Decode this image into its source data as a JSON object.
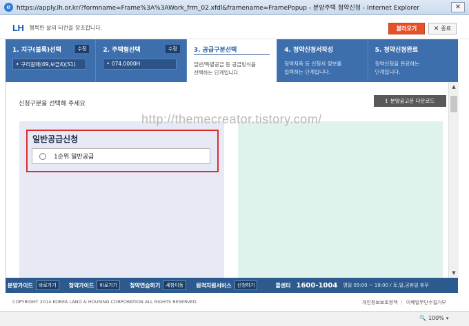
{
  "window": {
    "title": "https://apply.lh.or.kr/?formname=Frame%3A%3AWork_frm_02.xfdl&framename=FramePopup - 분양주택 청약신청 - Internet Explorer",
    "close_glyph": "✕"
  },
  "header": {
    "logo": "LH",
    "slogan": "행복한 삶의 터전을 창조합니다.",
    "load_button": "불러오기",
    "exit_button": "종료"
  },
  "steps": [
    {
      "title": "1. 지구(블록)선택",
      "edit": "수정",
      "value": "구리갈매(09,보금4)(S1)"
    },
    {
      "title": "2. 주택형선택",
      "edit": "수정",
      "value": "074.0000H"
    },
    {
      "title": "3. 공급구분선택",
      "desc_line1": "일반/특별공급 등 공급방식을",
      "desc_line2": "선택하는 단계입니다."
    },
    {
      "title": "4. 청약신청서작성",
      "desc_line1": "청약저축 등 신청서 정보를",
      "desc_line2": "입력하는 단계입니다."
    },
    {
      "title": "5. 청약신청완료",
      "desc_line1": "청약신청을 완료하는",
      "desc_line2": "단계입니다."
    }
  ],
  "main": {
    "instruction": "신청구분을 선택해 주세요",
    "download_button": "분양공고문 다운로드",
    "watermark": "http://themecreator.tistory.com/",
    "section_title": "일반공급신청",
    "option_label": "1순위 일반공급"
  },
  "footer_nav": {
    "items": [
      {
        "label": "분양가이드",
        "button": "바로가기"
      },
      {
        "label": "청약가이드",
        "button": "바로가기"
      },
      {
        "label": "청약연습하기",
        "button": "새창이동"
      },
      {
        "label": "원격지원서비스",
        "button": "신청하기"
      }
    ],
    "call_label": "콜센터",
    "phone": "1600-1004",
    "hours": "평일 09:00 ~ 18:00 / 토,일,공휴일 휴무"
  },
  "copyright": {
    "text": "COPYRIGHT 2014 KOREA LAND & HOUSING CORPORATION ALL RIGHTS RESERVED.",
    "privacy_link": "개인정보보호정책",
    "email_link": "이메일무단수집거부"
  },
  "statusbar": {
    "zoom": "100%"
  },
  "colors": {
    "accent": "#3e6fad",
    "highlight_border": "#e12b2b",
    "load_button": "#e5512a"
  }
}
